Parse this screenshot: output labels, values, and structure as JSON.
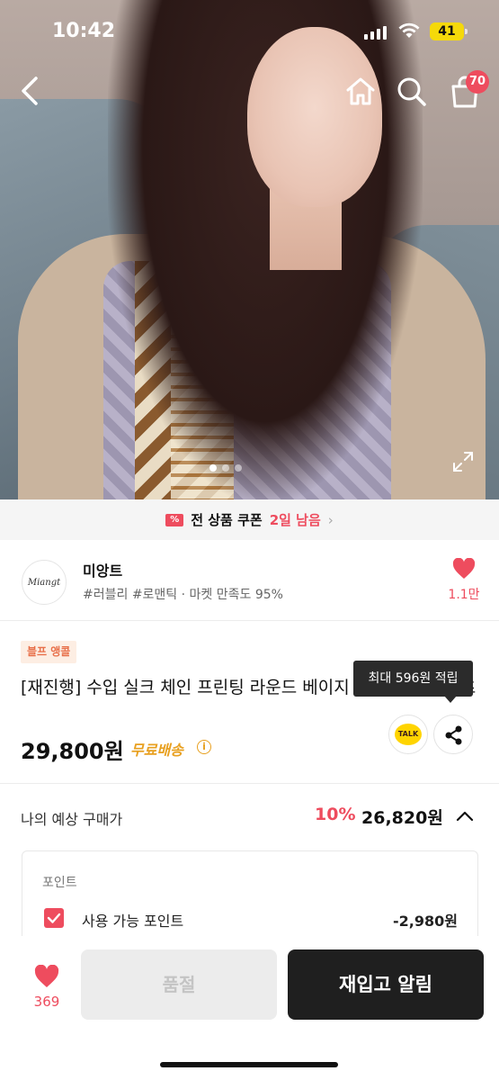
{
  "status_bar": {
    "time": "10:42",
    "battery": "41"
  },
  "nav": {
    "cart_count": "70"
  },
  "coupon_bar": {
    "text": "전 상품 쿠폰",
    "highlight": "2일 남음",
    "icon": "%"
  },
  "store": {
    "logo_text": "Miangt",
    "name": "미앙트",
    "tags": "#러블리 #로맨틱 · 마켓 만족도 95%",
    "favorite_count": "1.1만"
  },
  "product": {
    "badge": "블프 앵콜",
    "title": "[재진행] 수입 실크 체인 프린팅 라운드 베이지 반팔 니트 티셔츠",
    "price": "29,800원",
    "shipping": "무료배송",
    "info_symbol": "i",
    "tooltip": "최대 596원 적립",
    "talk_label": "TALK"
  },
  "expected": {
    "label": "나의 예상 구매가",
    "discount": "10%",
    "price": "26,820원"
  },
  "points": {
    "heading": "포인트",
    "label": "사용 가능 포인트",
    "value": "-2,980원"
  },
  "bottom_bar": {
    "like_count": "369",
    "soldout_label": "품절",
    "restock_label": "재입고 알림"
  },
  "colors": {
    "accent": "#ee4c5e",
    "shipping": "#e8a020",
    "dark_button": "#1f1f1f"
  }
}
